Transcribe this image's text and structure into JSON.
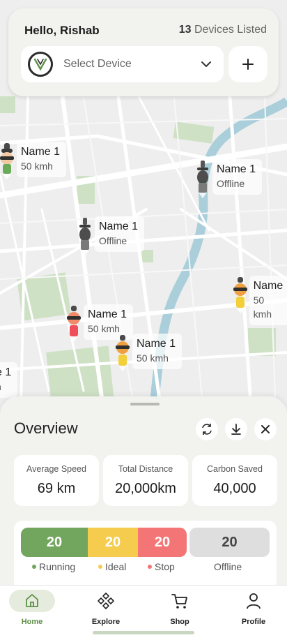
{
  "header": {
    "greeting": "Hello, Rishab",
    "device_count": "13",
    "device_suffix": " Devices Listed",
    "select_placeholder": "Select Device"
  },
  "markers": [
    {
      "name": "Name 1",
      "status": "50 kmh",
      "color": "green"
    },
    {
      "name": "Name 1",
      "status": "Offline",
      "color": "gray"
    },
    {
      "name": "Name 1",
      "status": "Offline",
      "color": "gray"
    },
    {
      "name": "Name",
      "status": "50 kmh",
      "color": "yellow"
    },
    {
      "name": "Name 1",
      "status": "50 kmh",
      "color": "red"
    },
    {
      "name": "Name 1",
      "status": "50 kmh",
      "color": "yellow"
    },
    {
      "name": "e 1",
      "status": "h",
      "color": "none"
    }
  ],
  "overview": {
    "title": "Overview",
    "stats": [
      {
        "label": "Average Speed",
        "value": "69 km"
      },
      {
        "label": "Total Distance",
        "value": "20,000km"
      },
      {
        "label": "Carbon Saved",
        "value": "40,000"
      }
    ],
    "status": [
      {
        "count": "20",
        "label": "Running",
        "color": "#72a55e"
      },
      {
        "count": "20",
        "label": "Ideal",
        "color": "#f5cc4d"
      },
      {
        "count": "20",
        "label": "Stop",
        "color": "#f47575"
      },
      {
        "count": "20",
        "label": "Offline",
        "color": "#dedede"
      }
    ]
  },
  "nav": {
    "items": [
      {
        "label": "Home",
        "icon": "home-icon",
        "active": true
      },
      {
        "label": "Explore",
        "icon": "explore-icon"
      },
      {
        "label": "Shop",
        "icon": "cart-icon"
      },
      {
        "label": "Profile",
        "icon": "profile-icon"
      }
    ]
  },
  "colors": {
    "accent": "#5d8f47",
    "river": "#aacfdb",
    "park": "#cfe1c5"
  }
}
